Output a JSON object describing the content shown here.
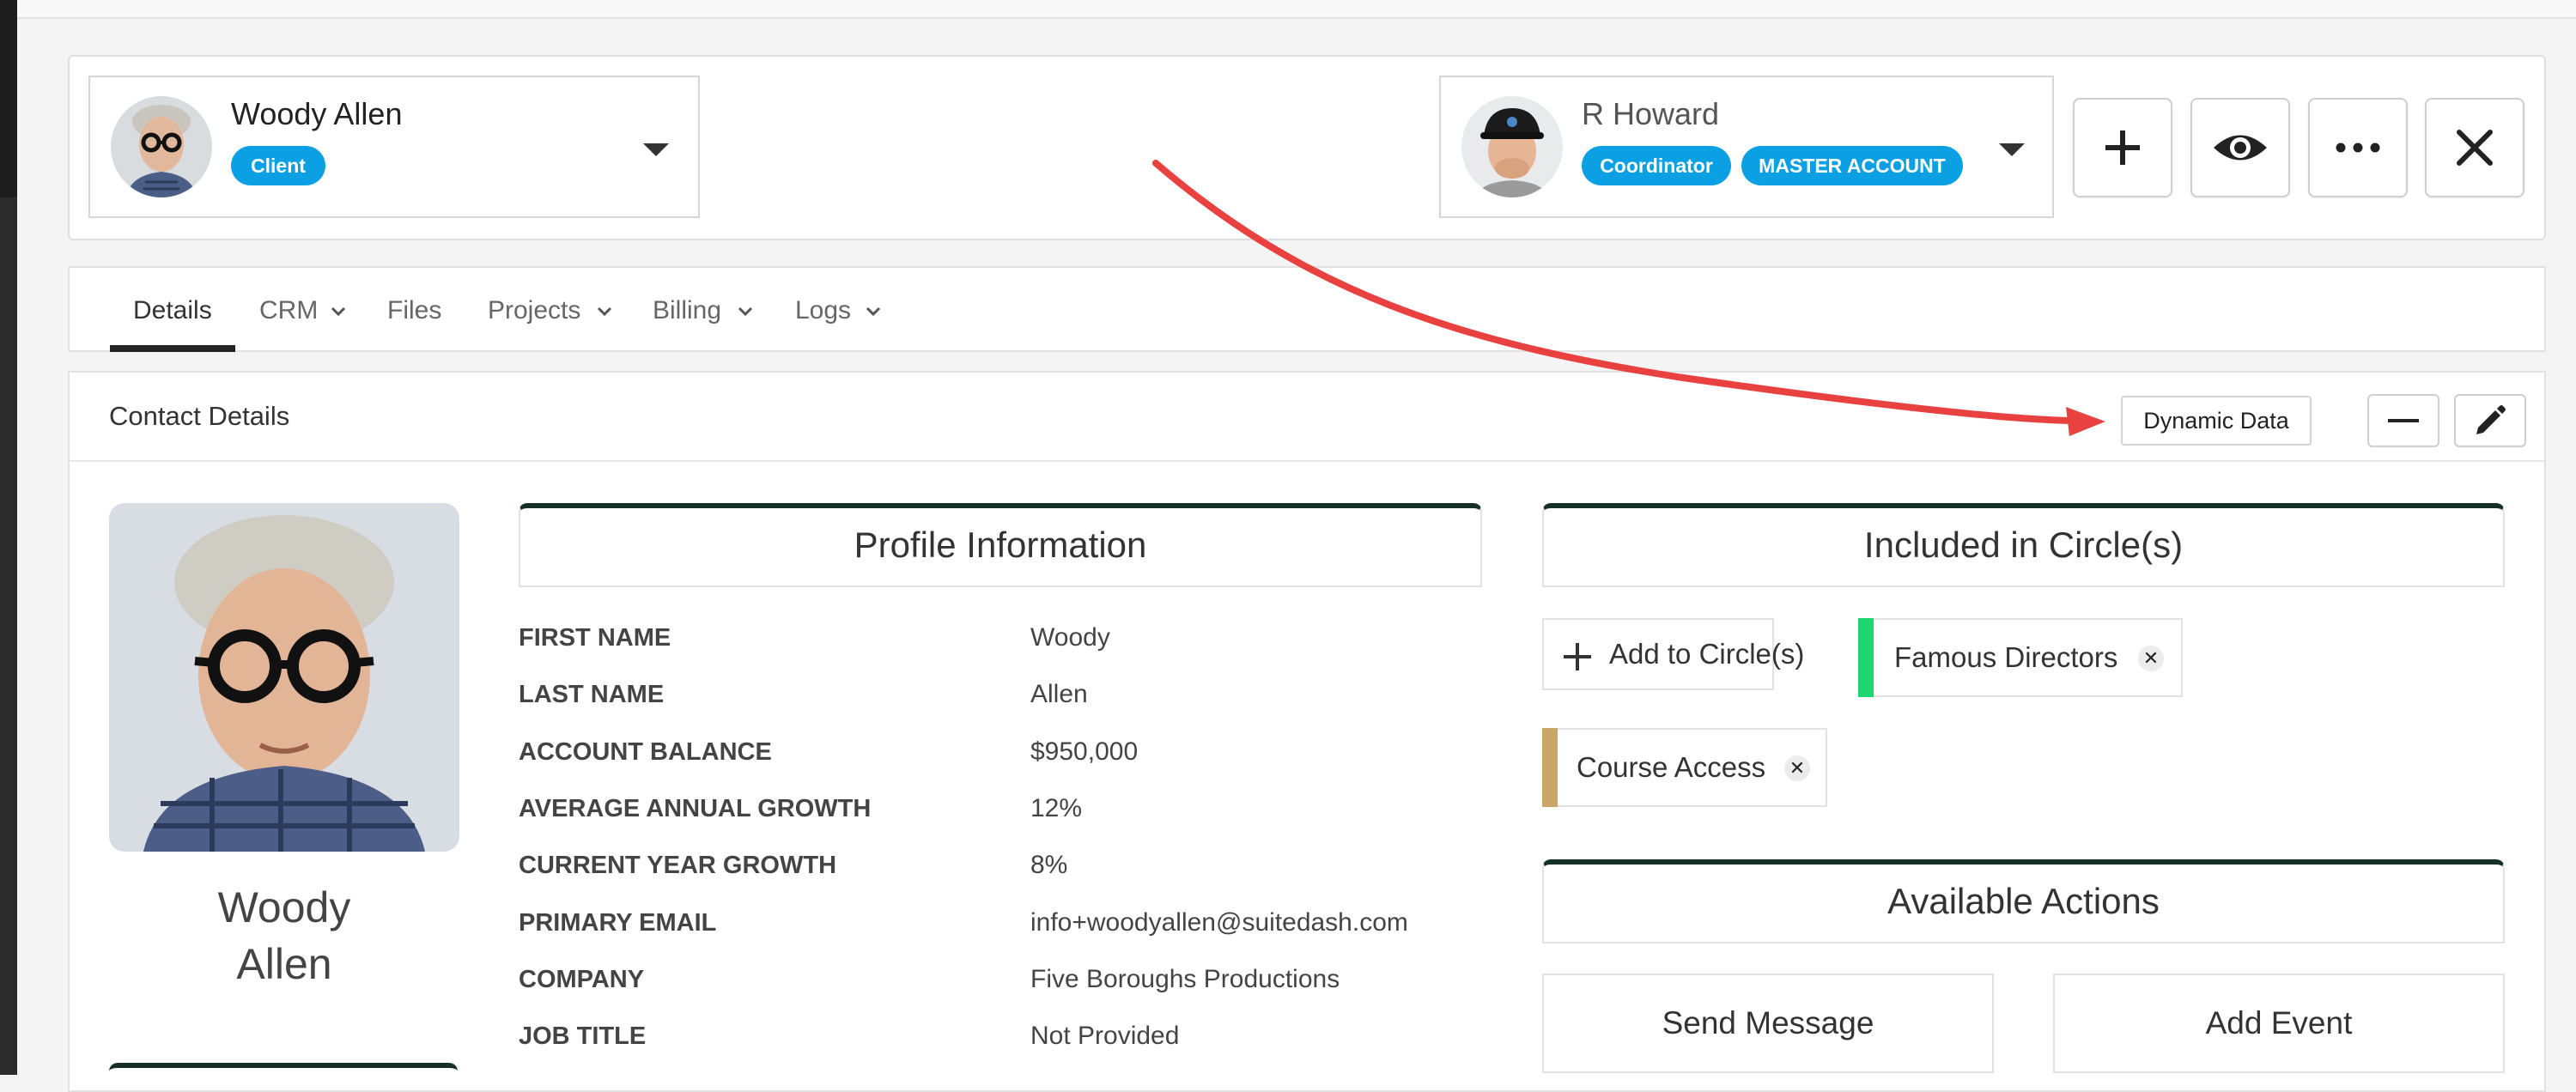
{
  "client": {
    "name": "Woody Allen",
    "role_badge": "Client"
  },
  "current_user": {
    "name": "R Howard",
    "badges": [
      "Coordinator",
      "MASTER ACCOUNT"
    ]
  },
  "header_actions": {
    "icons": [
      "plus-icon",
      "eye-icon",
      "ellipsis-icon",
      "close-icon"
    ]
  },
  "tabs": [
    {
      "label": "Details",
      "active": true,
      "has_dropdown": false
    },
    {
      "label": "CRM",
      "active": false,
      "has_dropdown": true
    },
    {
      "label": "Files",
      "active": false,
      "has_dropdown": false
    },
    {
      "label": "Projects",
      "active": false,
      "has_dropdown": true
    },
    {
      "label": "Billing",
      "active": false,
      "has_dropdown": true
    },
    {
      "label": "Logs",
      "active": false,
      "has_dropdown": true
    }
  ],
  "contact_details": {
    "title": "Contact Details",
    "dynamic_data_label": "Dynamic Data",
    "photo_name_first": "Woody",
    "photo_name_last": "Allen"
  },
  "profile": {
    "title": "Profile Information",
    "fields": [
      {
        "label": "FIRST NAME",
        "value": "Woody"
      },
      {
        "label": "LAST NAME",
        "value": "Allen"
      },
      {
        "label": "ACCOUNT BALANCE",
        "value": "$950,000"
      },
      {
        "label": "AVERAGE ANNUAL GROWTH",
        "value": "12%"
      },
      {
        "label": "CURRENT YEAR GROWTH",
        "value": "8%"
      },
      {
        "label": "PRIMARY EMAIL",
        "value": "info+woodyallen@suitedash.com"
      },
      {
        "label": "COMPANY",
        "value": "Five Boroughs Productions"
      },
      {
        "label": "JOB TITLE",
        "value": "Not Provided"
      }
    ]
  },
  "circles": {
    "title": "Included in Circle(s)",
    "add_label": "Add to Circle(s)",
    "items": [
      {
        "label": "Famous Directors",
        "color": "#1ed66f"
      },
      {
        "label": "Course Access",
        "color": "#c9a56a"
      }
    ]
  },
  "actions": {
    "title": "Available Actions",
    "buttons": [
      "Send Message",
      "Add Event"
    ]
  },
  "colors": {
    "accent_badge": "#0aa0e3",
    "section_border": "#163028",
    "annotation_arrow": "#e8413f"
  }
}
